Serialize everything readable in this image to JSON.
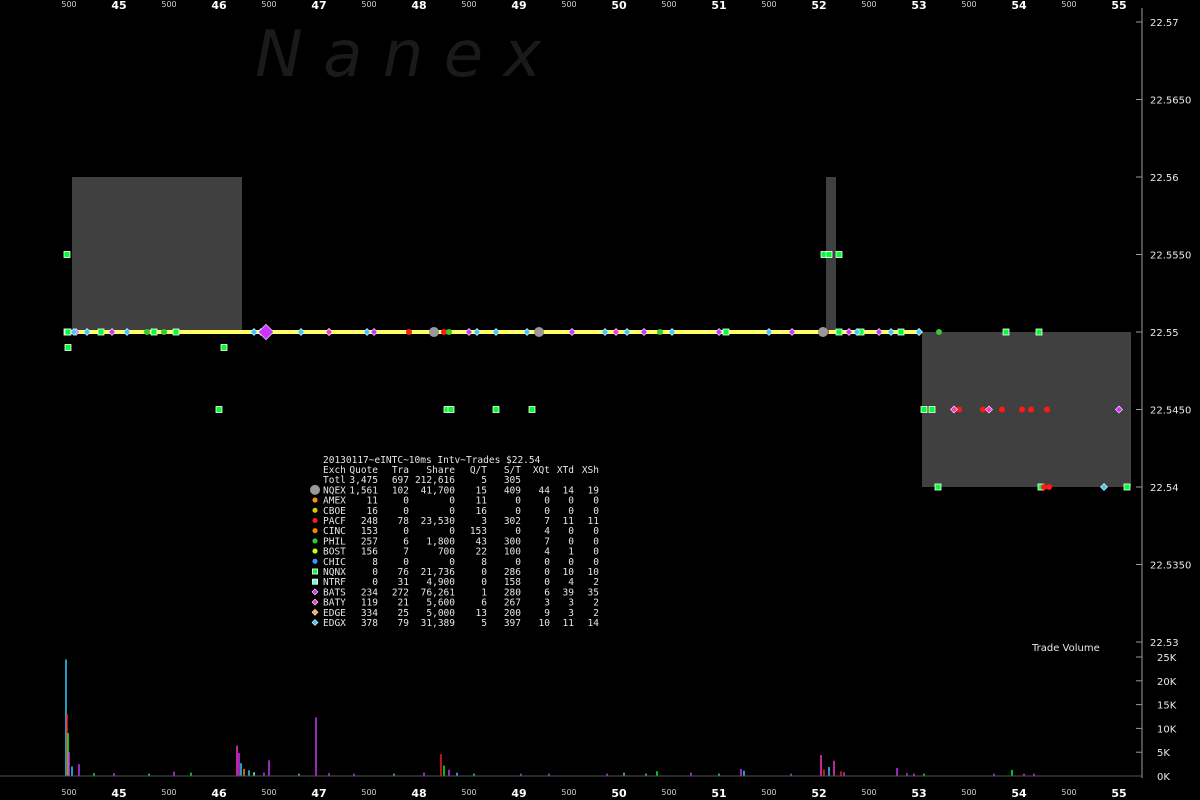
{
  "watermark": "N a n e x",
  "chart_data": {
    "type": "scatter",
    "title": "20130117~eINTC~10ms Intv~Trades $22.54",
    "x_major_ticks": [
      "45",
      "46",
      "47",
      "48",
      "49",
      "50",
      "51",
      "52",
      "53",
      "54",
      "55"
    ],
    "x_minor_tick_label": "500",
    "y_ticks": [
      "22.57",
      "22.5650",
      "22.56",
      "22.5550",
      "22.55",
      "22.5450",
      "22.54",
      "22.5350",
      "22.53"
    ],
    "ylim": [
      22.53,
      22.57
    ],
    "volume_label": "Trade Volume",
    "volume_ticks": [
      "25K",
      "20K",
      "15K",
      "10K",
      "5K",
      "0K"
    ],
    "volume_ylim": [
      0,
      25000
    ],
    "grid": false,
    "legend_columns": [
      "Exch",
      "Quote",
      "Tra",
      "Share",
      "Q/T",
      "S/T",
      "XQt",
      "XTd",
      "XSh"
    ],
    "legend_rows": [
      {
        "exch": "Totl",
        "quote": "3,475",
        "tra": "697",
        "share": "212,616",
        "qt": "5",
        "st": "305",
        "xqt": "",
        "xtd": "",
        "xsh": "",
        "color": "",
        "marker": "none"
      },
      {
        "exch": "NQEX",
        "quote": "1,561",
        "tra": "102",
        "share": "41,700",
        "qt": "15",
        "st": "409",
        "xqt": "44",
        "xtd": "14",
        "xsh": "19",
        "color": "#999999",
        "marker": "big-circle"
      },
      {
        "exch": "AMEX",
        "quote": "11",
        "tra": "0",
        "share": "0",
        "qt": "11",
        "st": "0",
        "xqt": "0",
        "xtd": "0",
        "xsh": "0",
        "color": "#ff8c1a",
        "marker": "circle"
      },
      {
        "exch": "CBOE",
        "quote": "16",
        "tra": "0",
        "share": "0",
        "qt": "16",
        "st": "0",
        "xqt": "0",
        "xtd": "0",
        "xsh": "0",
        "color": "#d4c814",
        "marker": "circle"
      },
      {
        "exch": "PACF",
        "quote": "248",
        "tra": "78",
        "share": "23,530",
        "qt": "3",
        "st": "302",
        "xqt": "7",
        "xtd": "11",
        "xsh": "11",
        "color": "#ff1a1a",
        "marker": "circle"
      },
      {
        "exch": "CINC",
        "quote": "153",
        "tra": "0",
        "share": "0",
        "qt": "153",
        "st": "0",
        "xqt": "4",
        "xtd": "0",
        "xsh": "0",
        "color": "#ff7f00",
        "marker": "circle"
      },
      {
        "exch": "PHIL",
        "quote": "257",
        "tra": "6",
        "share": "1,800",
        "qt": "43",
        "st": "300",
        "xqt": "7",
        "xtd": "0",
        "xsh": "0",
        "color": "#33cc33",
        "marker": "circle"
      },
      {
        "exch": "BOST",
        "quote": "156",
        "tra": "7",
        "share": "700",
        "qt": "22",
        "st": "100",
        "xqt": "4",
        "xtd": "1",
        "xsh": "0",
        "color": "#ccff00",
        "marker": "circle"
      },
      {
        "exch": "CHIC",
        "quote": "8",
        "tra": "0",
        "share": "0",
        "qt": "8",
        "st": "0",
        "xqt": "0",
        "xtd": "0",
        "xsh": "0",
        "color": "#3399ff",
        "marker": "circle"
      },
      {
        "exch": "NQNX",
        "quote": "0",
        "tra": "76",
        "share": "21,736",
        "qt": "0",
        "st": "286",
        "xqt": "0",
        "xtd": "10",
        "xsh": "10",
        "color": "#00ff33",
        "marker": "square"
      },
      {
        "exch": "NTRF",
        "quote": "0",
        "tra": "31",
        "share": "4,900",
        "qt": "0",
        "st": "158",
        "xqt": "0",
        "xtd": "4",
        "xsh": "2",
        "color": "#66ffcc",
        "marker": "square"
      },
      {
        "exch": "BATS",
        "quote": "234",
        "tra": "272",
        "share": "76,261",
        "qt": "1",
        "st": "280",
        "xqt": "6",
        "xtd": "39",
        "xsh": "35",
        "color": "#cc33ff",
        "marker": "diamond"
      },
      {
        "exch": "BATY",
        "quote": "119",
        "tra": "21",
        "share": "5,600",
        "qt": "6",
        "st": "267",
        "xqt": "3",
        "xtd": "3",
        "xsh": "2",
        "color": "#ff33cc",
        "marker": "diamond"
      },
      {
        "exch": "EDGE",
        "quote": "334",
        "tra": "25",
        "share": "5,000",
        "qt": "13",
        "st": "200",
        "xqt": "9",
        "xtd": "3",
        "xsh": "2",
        "color": "#ffaa33",
        "marker": "diamond"
      },
      {
        "exch": "EDGX",
        "quote": "378",
        "tra": "79",
        "share": "31,389",
        "qt": "5",
        "st": "397",
        "xqt": "10",
        "xtd": "11",
        "xsh": "14",
        "color": "#33ccff",
        "marker": "diamond"
      }
    ],
    "nbbo_spread_bands": [
      {
        "x0": 44.53,
        "x1": 46.23,
        "low": 22.55,
        "high": 22.56
      },
      {
        "x0": 52.07,
        "x1": 52.17,
        "low": 22.55,
        "high": 22.56
      },
      {
        "x0": 53.03,
        "x1": 55.12,
        "low": 22.54,
        "high": 22.55
      }
    ],
    "last_trade_line": {
      "x0": 44.47,
      "x1": 53.0,
      "y": 22.55,
      "color": "#ffff66"
    },
    "trade_series": [
      {
        "exch": "NQNX",
        "x": [
          44.48,
          44.48,
          44.49,
          44.49,
          44.82,
          45.35,
          45.57,
          46.0,
          46.05,
          48.28,
          48.32,
          48.77,
          49.13,
          51.07,
          52.05,
          52.1,
          52.2,
          52.2,
          52.42,
          52.82,
          53.05,
          53.13,
          53.19,
          53.87,
          54.2,
          54.22,
          55.08
        ],
        "y": [
          22.555,
          22.55,
          22.549,
          22.55,
          22.55,
          22.55,
          22.55,
          22.545,
          22.549,
          22.545,
          22.545,
          22.545,
          22.545,
          22.55,
          22.555,
          22.555,
          22.555,
          22.55,
          22.55,
          22.55,
          22.545,
          22.545,
          22.54,
          22.55,
          22.55,
          22.54,
          22.54
        ]
      },
      {
        "exch": "BATS",
        "x": [
          44.57,
          44.93,
          46.42,
          46.47,
          47.55,
          48.5,
          49.53,
          50.25,
          51.0,
          51.73,
          52.3,
          52.6,
          53.0,
          55.0
        ],
        "y": [
          22.55,
          22.55,
          22.55,
          22.55,
          22.55,
          22.55,
          22.55,
          22.55,
          22.55,
          22.55,
          22.55,
          22.55,
          22.55,
          22.545
        ]
      },
      {
        "exch": "PACF",
        "x": [
          47.9,
          48.25,
          52.07,
          53.4,
          53.64,
          53.83,
          54.03,
          54.12,
          54.25,
          54.28,
          54.3
        ],
        "y": [
          22.55,
          22.55,
          22.55,
          22.545,
          22.545,
          22.545,
          22.545,
          22.545,
          22.54,
          22.545,
          22.54
        ]
      },
      {
        "exch": "EDGX",
        "x": [
          44.55,
          44.68,
          45.08,
          46.35,
          46.82,
          47.1,
          47.48,
          48.58,
          48.77,
          49.08,
          49.86,
          50.08,
          50.53,
          51.5,
          52.38,
          52.72,
          53.0,
          54.85
        ],
        "y": [
          22.55,
          22.55,
          22.55,
          22.55,
          22.55,
          22.55,
          22.55,
          22.55,
          22.55,
          22.55,
          22.55,
          22.55,
          22.55,
          22.55,
          22.55,
          22.55,
          22.55,
          22.54
        ]
      },
      {
        "exch": "PHIL",
        "x": [
          45.28,
          45.45,
          48.3,
          50.41,
          53.2
        ],
        "y": [
          22.55,
          22.55,
          22.55,
          22.55,
          22.55
        ]
      },
      {
        "exch": "NQEX",
        "x": [
          52.04,
          48.15,
          49.2
        ],
        "y": [
          22.55,
          22.55,
          22.55
        ]
      },
      {
        "exch": "BATY",
        "x": [
          47.1,
          49.97,
          53.35,
          53.7
        ],
        "y": [
          22.55,
          22.55,
          22.545,
          22.545
        ]
      }
    ],
    "volume_bars": [
      {
        "x": 44.47,
        "v": 24500,
        "color": "#33ccff"
      },
      {
        "x": 44.48,
        "v": 13000,
        "color": "#ff1a1a"
      },
      {
        "x": 44.49,
        "v": 9000,
        "color": "#00ff33"
      },
      {
        "x": 44.5,
        "v": 5000,
        "color": "#cc33ff"
      },
      {
        "x": 44.53,
        "v": 2000,
        "color": "#33ccff"
      },
      {
        "x": 44.6,
        "v": 2500,
        "color": "#cc33ff"
      },
      {
        "x": 44.75,
        "v": 600,
        "color": "#00ff33"
      },
      {
        "x": 44.95,
        "v": 600,
        "color": "#cc33ff"
      },
      {
        "x": 45.3,
        "v": 500,
        "color": "#00ff33"
      },
      {
        "x": 45.55,
        "v": 900,
        "color": "#cc33ff"
      },
      {
        "x": 45.72,
        "v": 700,
        "color": "#00ff33"
      },
      {
        "x": 46.18,
        "v": 6400,
        "color": "#ff33cc"
      },
      {
        "x": 46.2,
        "v": 4800,
        "color": "#cc33ff"
      },
      {
        "x": 46.22,
        "v": 2700,
        "color": "#33ccff"
      },
      {
        "x": 46.25,
        "v": 1500,
        "color": "#ff8c1a"
      },
      {
        "x": 46.3,
        "v": 1200,
        "color": "#33ccff"
      },
      {
        "x": 46.35,
        "v": 800,
        "color": "#66ffcc"
      },
      {
        "x": 46.45,
        "v": 700,
        "color": "#cc33ff"
      },
      {
        "x": 46.5,
        "v": 3300,
        "color": "#cc33ff"
      },
      {
        "x": 46.8,
        "v": 500,
        "color": "#33ccff"
      },
      {
        "x": 46.97,
        "v": 12300,
        "color": "#cc33ff"
      },
      {
        "x": 47.1,
        "v": 600,
        "color": "#cc33ff"
      },
      {
        "x": 47.35,
        "v": 500,
        "color": "#cc33ff"
      },
      {
        "x": 47.75,
        "v": 500,
        "color": "#33ccff"
      },
      {
        "x": 48.05,
        "v": 700,
        "color": "#cc33ff"
      },
      {
        "x": 48.22,
        "v": 4600,
        "color": "#ff1a1a"
      },
      {
        "x": 48.25,
        "v": 2200,
        "color": "#00ff33"
      },
      {
        "x": 48.3,
        "v": 1300,
        "color": "#cc33ff"
      },
      {
        "x": 48.38,
        "v": 700,
        "color": "#33ccff"
      },
      {
        "x": 48.55,
        "v": 500,
        "color": "#00ff33"
      },
      {
        "x": 49.02,
        "v": 500,
        "color": "#cc33ff"
      },
      {
        "x": 49.3,
        "v": 500,
        "color": "#cc33ff"
      },
      {
        "x": 49.88,
        "v": 500,
        "color": "#cc33ff"
      },
      {
        "x": 50.05,
        "v": 700,
        "color": "#33ccff"
      },
      {
        "x": 50.27,
        "v": 500,
        "color": "#33ccff"
      },
      {
        "x": 50.38,
        "v": 1000,
        "color": "#00ff33"
      },
      {
        "x": 50.72,
        "v": 700,
        "color": "#cc33ff"
      },
      {
        "x": 51.0,
        "v": 500,
        "color": "#33ccff"
      },
      {
        "x": 51.22,
        "v": 1500,
        "color": "#cc33ff"
      },
      {
        "x": 51.25,
        "v": 1100,
        "color": "#33ccff"
      },
      {
        "x": 51.72,
        "v": 500,
        "color": "#cc33ff"
      },
      {
        "x": 52.02,
        "v": 4400,
        "color": "#ff33cc"
      },
      {
        "x": 52.05,
        "v": 1400,
        "color": "#ff1a1a"
      },
      {
        "x": 52.1,
        "v": 1900,
        "color": "#33ccff"
      },
      {
        "x": 52.15,
        "v": 3200,
        "color": "#ff33cc"
      },
      {
        "x": 52.22,
        "v": 1000,
        "color": "#ff1a1a"
      },
      {
        "x": 52.25,
        "v": 800,
        "color": "#cc33ff"
      },
      {
        "x": 52.78,
        "v": 1700,
        "color": "#cc33ff"
      },
      {
        "x": 52.88,
        "v": 600,
        "color": "#cc33ff"
      },
      {
        "x": 52.95,
        "v": 500,
        "color": "#ff33cc"
      },
      {
        "x": 53.05,
        "v": 500,
        "color": "#00ff33"
      },
      {
        "x": 53.75,
        "v": 500,
        "color": "#cc33ff"
      },
      {
        "x": 53.93,
        "v": 1300,
        "color": "#00ff33"
      },
      {
        "x": 54.05,
        "v": 500,
        "color": "#ff33cc"
      },
      {
        "x": 54.15,
        "v": 500,
        "color": "#cc33ff"
      }
    ]
  }
}
